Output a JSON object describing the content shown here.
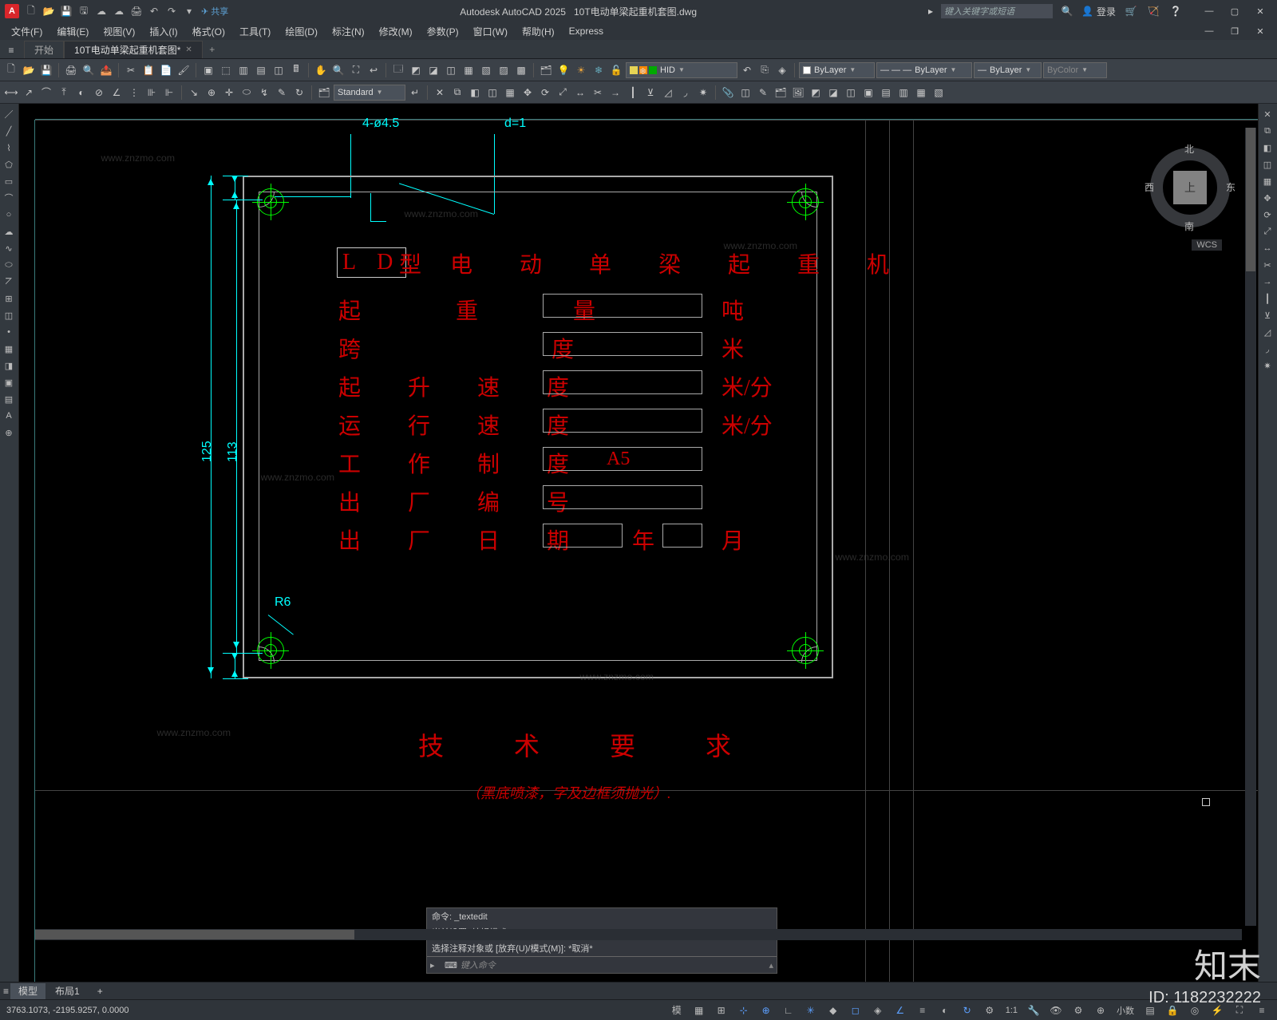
{
  "titlebar": {
    "logo": "A",
    "share": "共享",
    "app_title": "Autodesk AutoCAD 2025",
    "doc_title": "10T电动单梁起重机套图.dwg",
    "search_placeholder": "键入关键字或短语",
    "login": "登录"
  },
  "menubar": {
    "items": [
      "文件(F)",
      "编辑(E)",
      "视图(V)",
      "插入(I)",
      "格式(O)",
      "工具(T)",
      "绘图(D)",
      "标注(N)",
      "修改(M)",
      "参数(P)",
      "窗口(W)",
      "帮助(H)",
      "Express"
    ]
  },
  "doc_tabs": {
    "start": "开始",
    "active": "10T电动单梁起重机套图*",
    "plus": "+"
  },
  "toolbar": {
    "layer_hid": "HID",
    "bylayer": "ByLayer",
    "linetype": "ByLayer",
    "lineweight": "ByLayer",
    "bycolor": "ByColor",
    "standard": "Standard"
  },
  "drawing": {
    "dim_hole": "4-ø4.5",
    "dim_d": "d=1",
    "dim_R6": "R6",
    "dim_125": "125",
    "dim_113": "113",
    "ld": "L D",
    "ld_type": "型",
    "title_rest": "电 动 单 梁 起 重 机",
    "rows": [
      {
        "label": "起 重 量",
        "unit": "吨"
      },
      {
        "label": "跨   度",
        "unit": "米"
      },
      {
        "label": "起 升 速 度",
        "unit": "米/分"
      },
      {
        "label": "运 行 速 度",
        "unit": "米/分"
      },
      {
        "label": "工 作 制 度",
        "value": "A5",
        "unit": ""
      },
      {
        "label": "出 厂 编 号",
        "unit": ""
      },
      {
        "label": "出 厂 日 期",
        "unit": ""
      }
    ],
    "year": "年",
    "month": "月",
    "tech_req": "技 术 要 求",
    "note_below": "（黑底喷漆，字及边框须抛光）."
  },
  "nav": {
    "top_face": "上",
    "n": "北",
    "s": "南",
    "e": "东",
    "w": "西",
    "wcs": "WCS"
  },
  "cmd": {
    "l1": "命令: _textedit",
    "l2": "当前设置: 编辑模式 = Multiple",
    "l3": "选择注释对象或 [放弃(U)/模式(M)]: *取消*",
    "placeholder": "键入命令"
  },
  "model_tabs": {
    "model": "模型",
    "layout1": "布局1",
    "plus": "+"
  },
  "status": {
    "coords": "3763.1073, -2195.9257, 0.0000",
    "scale": "1:1",
    "decimal": "小数"
  },
  "site": {
    "logo": "知末",
    "id": "ID: 1182232222",
    "wm": "www.znzmo.com"
  }
}
